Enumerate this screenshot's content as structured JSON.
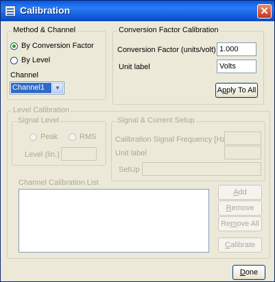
{
  "window": {
    "title": "Calibration"
  },
  "method_channel": {
    "group_label": "Method & Channel",
    "option_conversion": "By Conversion Factor",
    "option_level": "By Level",
    "channel_label": "Channel",
    "channel_value": "Channel1"
  },
  "conversion": {
    "group_label": "Conversion Factor Calibration",
    "factor_label": "Conversion Factor (units/volt)",
    "factor_value": "1.000",
    "unit_label": "Unit label",
    "unit_value": "Volts",
    "apply_all": {
      "pre": "A",
      "key": "p",
      "post": "ply To All"
    }
  },
  "level_calibration": {
    "group_label": "Level Calibration",
    "signal_level": {
      "group_label": "Signal Level",
      "peak": "Peak",
      "rms": "RMS",
      "level_label": "Level (lin.)"
    },
    "signal_current": {
      "group_label": "Signal & Current Setup",
      "frequency_label": "Calibration Signal Frequency [Hz]",
      "unit_label": "Unit label",
      "setup_label": "SetUp"
    },
    "channel_list_label": "Channel Calibration List",
    "add": {
      "pre": "",
      "key": "A",
      "post": "dd"
    },
    "remove": {
      "pre": "",
      "key": "R",
      "post": "emove"
    },
    "remove_all": {
      "pre": "Re",
      "key": "m",
      "post": "ove All"
    },
    "calibrate": {
      "pre": "",
      "key": "C",
      "post": "alibrate"
    }
  },
  "done": {
    "pre": "",
    "key": "D",
    "post": "one"
  },
  "icons": {
    "window": "calibration-app-icon",
    "close": "close-icon",
    "dropdown": "chevron-down-icon"
  },
  "colors": {
    "titlebar": "#0a58e0",
    "close": "#c4361a",
    "selection": "#316ac5",
    "radio_checked": "#21a121"
  }
}
